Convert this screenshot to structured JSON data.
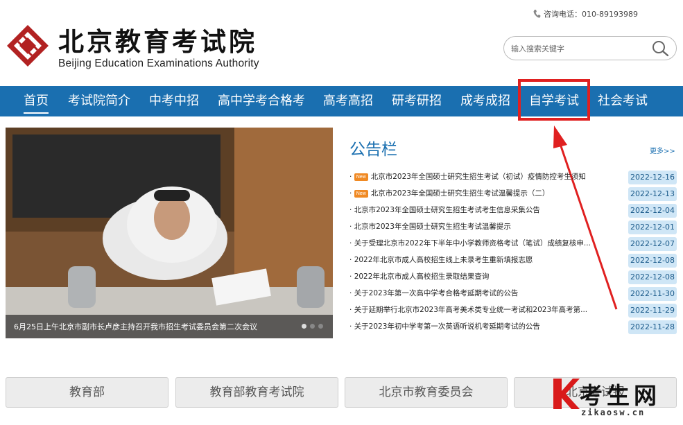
{
  "header": {
    "logo_cn": "北京教育考试院",
    "logo_en": "Beijing Education Examinations Authority",
    "hotline": "咨询电话：010-89193989",
    "search_placeholder": "输入搜索关键字"
  },
  "nav": {
    "items": [
      "首页",
      "考试院简介",
      "中考中招",
      "高中学考合格考",
      "高考高招",
      "研考研招",
      "成考成招",
      "自学考试",
      "社会考试"
    ],
    "active": "首页",
    "highlighted": "自学考试",
    "highlight_color": "#e02020",
    "bar_color": "#1a6fb0"
  },
  "slide": {
    "caption": "6月25日上午北京市副市长卢彦主持召开我市招生考试委员会第二次会议",
    "slide_count": 3,
    "active_index": 0
  },
  "board": {
    "title": "公告栏",
    "more": "更多>>",
    "badge": "New",
    "items": [
      {
        "title": "北京市2023年全国硕士研究生招生考试（初试）疫情防控考生须知",
        "date": "2022-12-16",
        "new": true
      },
      {
        "title": "北京市2023年全国硕士研究生招生考试温馨提示（二）",
        "date": "2022-12-13",
        "new": true
      },
      {
        "title": "北京市2023年全国硕士研究生招生考试考生信息采集公告",
        "date": "2022-12-04",
        "new": false
      },
      {
        "title": "北京市2023年全国硕士研究生招生考试温馨提示",
        "date": "2022-12-01",
        "new": false
      },
      {
        "title": "关于受理北京市2022年下半年中小学教师资格考试（笔试）成绩复核申...",
        "date": "2022-12-07",
        "new": false
      },
      {
        "title": "2022年北京市成人高校招生线上未录考生重新填报志愿",
        "date": "2022-12-08",
        "new": false
      },
      {
        "title": "2022年北京市成人高校招生录取结果查询",
        "date": "2022-12-08",
        "new": false
      },
      {
        "title": "关于2023年第一次高中学考合格考延期考试的公告",
        "date": "2022-11-30",
        "new": false
      },
      {
        "title": "关于延期举行北京市2023年高考美术类专业统一考试和2023年高考第...",
        "date": "2022-11-29",
        "new": false
      },
      {
        "title": "关于2023年初中学考第一次英语听说机考延期考试的公告",
        "date": "2022-11-28",
        "new": false
      }
    ]
  },
  "links": [
    "教育部",
    "教育部教育考试院",
    "北京市教育委员会",
    "北京考试报"
  ],
  "watermark": {
    "cn": "考生网",
    "en": "zikaosw.cn"
  }
}
